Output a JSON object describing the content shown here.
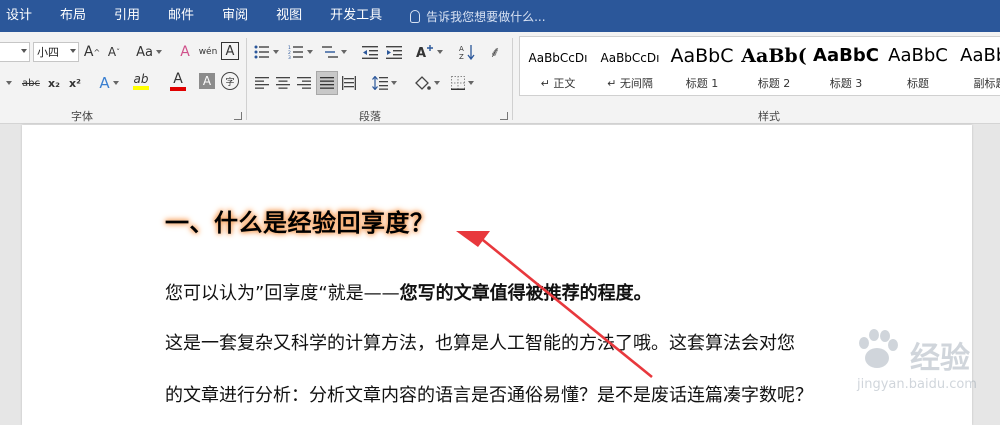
{
  "menubar": {
    "tabs": [
      "设计",
      "布局",
      "引用",
      "邮件",
      "审阅",
      "视图",
      "开发工具"
    ],
    "tellme": "告诉我您想要做什么..."
  },
  "ribbon": {
    "font_size": "小四",
    "font_group_label": "字体",
    "paragraph_group_label": "段落",
    "styles_group_label": "样式",
    "styles": [
      {
        "preview": "AaBbCcDı",
        "name": "↵ 正文"
      },
      {
        "preview": "AaBbCcDı",
        "name": "↵ 无间隔"
      },
      {
        "preview": "AaBbC",
        "name": "标题 1"
      },
      {
        "preview": "AaBb(",
        "name": "标题 2"
      },
      {
        "preview": "AaBbC",
        "name": "标题 3"
      },
      {
        "preview": "AaBbC",
        "name": "标题"
      },
      {
        "preview": "AaBbC",
        "name": "副标题"
      }
    ],
    "buttons": {
      "grow": "A",
      "shrink": "A",
      "case": "Aa",
      "clear": "A",
      "phonetic": "wén",
      "border_char": "A",
      "strike": "abc",
      "sub": "x₂",
      "sup": "x²",
      "effects": "A",
      "highlight": "ab",
      "font_color": "A",
      "shade": "A",
      "enclose": "字"
    }
  },
  "document": {
    "heading": "一、什么是经验回享度？",
    "para1_normal": "您可以认为”回享度“就是——",
    "para1_bold": "您写的文章值得被推荐的程度。",
    "para2": "这是一套复杂又科学的计算方法，也算是人工智能的方法了哦。这套算法会对您",
    "para3": "的文章进行分析：分析文章内容的语言是否通俗易懂？是不是废话连篇凑字数呢？"
  },
  "watermark": {
    "text": "经验",
    "url": "jingyan.baidu.com"
  },
  "colors": {
    "titlebar": "#2b579a",
    "highlight_bar": "#ffff00",
    "font_color_bar": "#e00000",
    "arrow": "#e8383d"
  }
}
